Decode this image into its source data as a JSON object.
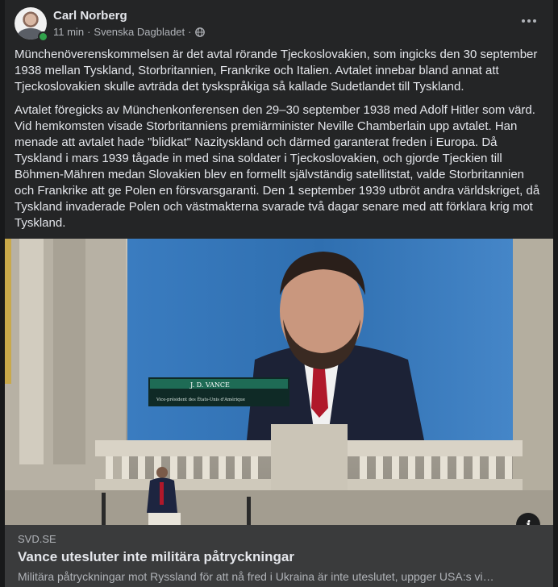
{
  "post": {
    "author": "Carl Norberg",
    "time": "11 min",
    "separator": "·",
    "source": "Svenska Dagbladet",
    "audience_icon": "globe-icon",
    "paragraphs": [
      "Münchenöverenskommelsen är det avtal rörande Tjeckoslovakien, som ingicks den 30 september 1938 mellan Tyskland, Storbritannien, Frankrike och Italien. Avtalet innebar bland annat att Tjeckoslovakien skulle avträda det tyskspråkiga så kallade Sudetlandet till Tyskland.",
      "Avtalet föregicks av Münchenkonferensen den 29–30 september 1938 med Adolf Hitler som värd. Vid hemkomsten visade Storbritanniens premiärminister Neville Chamberlain upp avtalet. Han menade att avtalet hade \"blidkat\" Nazityskland och därmed garanterat freden i Europa. Då Tyskland i mars 1939 tågade in med sina soldater i Tjeckoslovakien, och gjorde Tjeckien till Böhmen-Mähren medan Slovakien blev en formellt självständig satellitstat, valde Storbritannien och Frankrike att ge Polen en försvarsgaranti. Den 1 september 1939 utbröt andra världskriget, då Tyskland invaderade Polen och västmakterna svarade två dagar senare med att förklara krig mot Tyskland."
    ]
  },
  "image": {
    "nameplate_title": "J. D. VANCE",
    "nameplate_subtitle": "Vice-président des États-Unis d'Amérique"
  },
  "link": {
    "domain": "SVD.SE",
    "title": "Vance utesluter inte militära påtryckningar",
    "description": "Militära påtryckningar mot Ryssland för att nå fred i Ukraina är inte uteslutet, uppger USA:s vi…"
  },
  "colors": {
    "background": "#18191a",
    "card": "#242526",
    "preview": "#3a3b3c",
    "online": "#31a24c",
    "screen_blue": "#2f6fb0"
  }
}
